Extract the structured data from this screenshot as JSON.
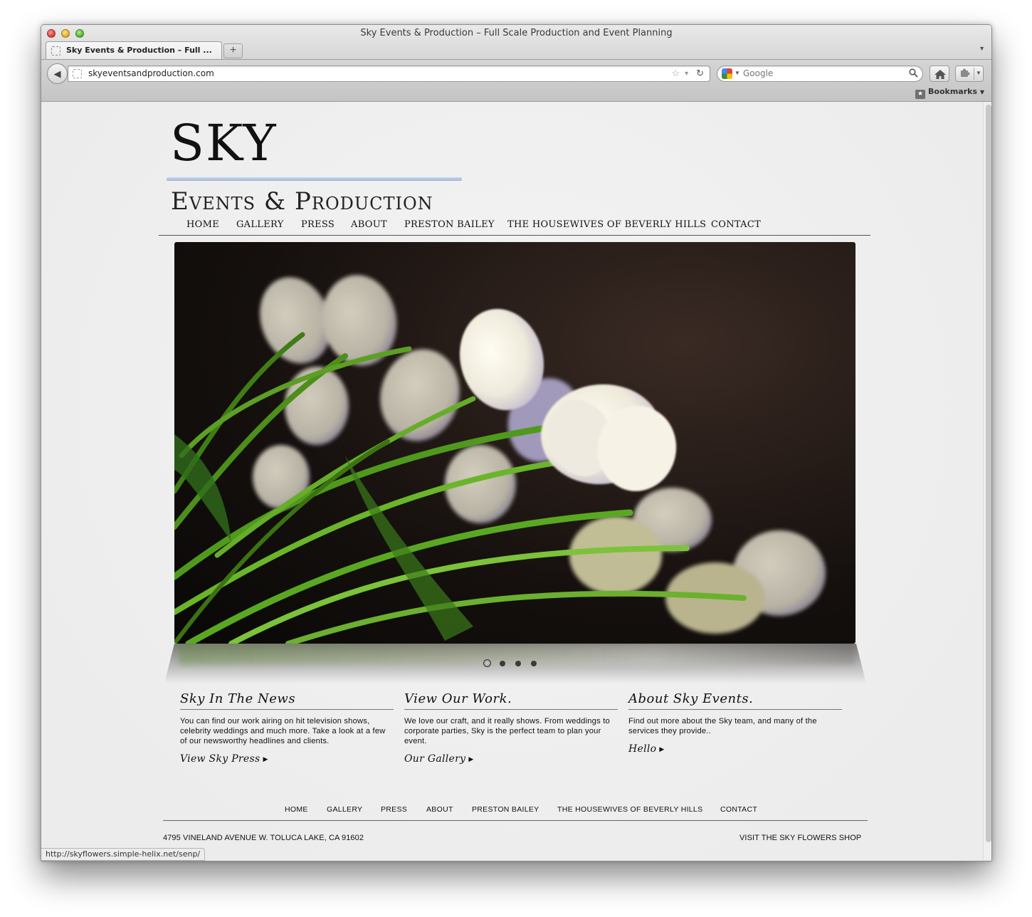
{
  "browser": {
    "window_title": "Sky Events & Production – Full Scale Production and Event Planning",
    "tab_label": "Sky Events & Production – Full ...",
    "new_tab_symbol": "+",
    "url": "skyeventsandproduction.com",
    "search_placeholder": "Google",
    "bookmarks_label": "Bookmarks",
    "status_url": "http://skyflowers.simple-helix.net/senp/"
  },
  "logo": {
    "title": "SKY",
    "subtitle": "Events & Production",
    "rule_color": "#a9bde0"
  },
  "nav": {
    "items": [
      "HOME",
      "GALLERY",
      "PRESS",
      "ABOUT",
      "PRESTON BAILEY",
      "THE HOUSEWIVES OF BEVERLY HILLS",
      "CONTACT"
    ]
  },
  "slider": {
    "image": "white-tulips-on-dark-background",
    "dot_count": 4,
    "active_dot": 1
  },
  "columns": [
    {
      "title": "Sky In The News",
      "body": "You can find our work airing on hit television shows, celebrity weddings and much more. Take a look at a few of our newsworthy headlines and clients.",
      "link": "View Sky Press"
    },
    {
      "title": "View Our Work.",
      "body": "We love our craft, and it really shows. From weddings to corporate parties, Sky is the perfect team to plan your event.",
      "link": "Our Gallery"
    },
    {
      "title": "About Sky Events.",
      "body": "Find out more about the Sky team, and many of the services they provide..",
      "link": "Hello"
    }
  ],
  "footer": {
    "nav": [
      "HOME",
      "GALLERY",
      "PRESS",
      "ABOUT",
      "PRESTON BAILEY",
      "THE HOUSEWIVES OF BEVERLY HILLS",
      "CONTACT"
    ],
    "address": "4795 VINELAND AVENUE W. TOLUCA LAKE, CA 91602",
    "shop_link": "VISIT THE SKY FLOWERS SHOP"
  }
}
